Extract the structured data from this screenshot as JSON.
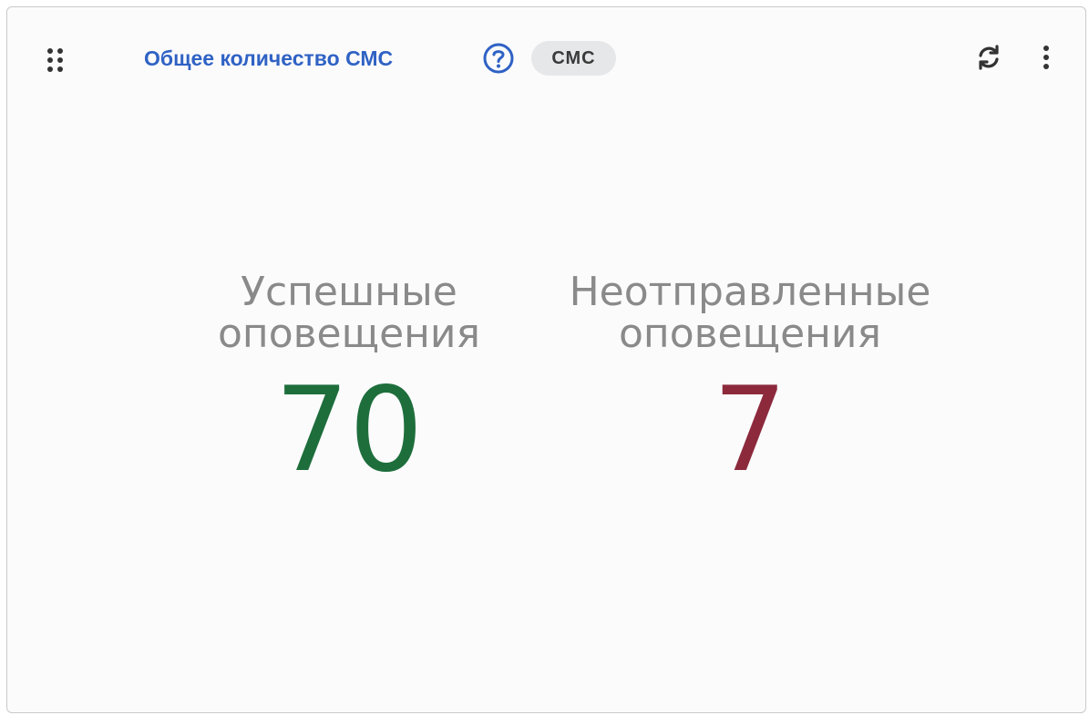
{
  "widget": {
    "title": "Общее количество СМС",
    "badge": "СМС",
    "icons": {
      "drag": "drag-handle-icon",
      "help": "help-circle-icon",
      "refresh": "refresh-icon",
      "menu": "more-vertical-icon"
    },
    "accent_color": "#2f62c4"
  },
  "stats": {
    "success": {
      "label": "Успешные\nоповещения",
      "value": "70",
      "color": "#1e6e3c"
    },
    "failed": {
      "label": "Неотправленные\nоповещения",
      "value": "7",
      "color": "#8c2a3c"
    }
  }
}
